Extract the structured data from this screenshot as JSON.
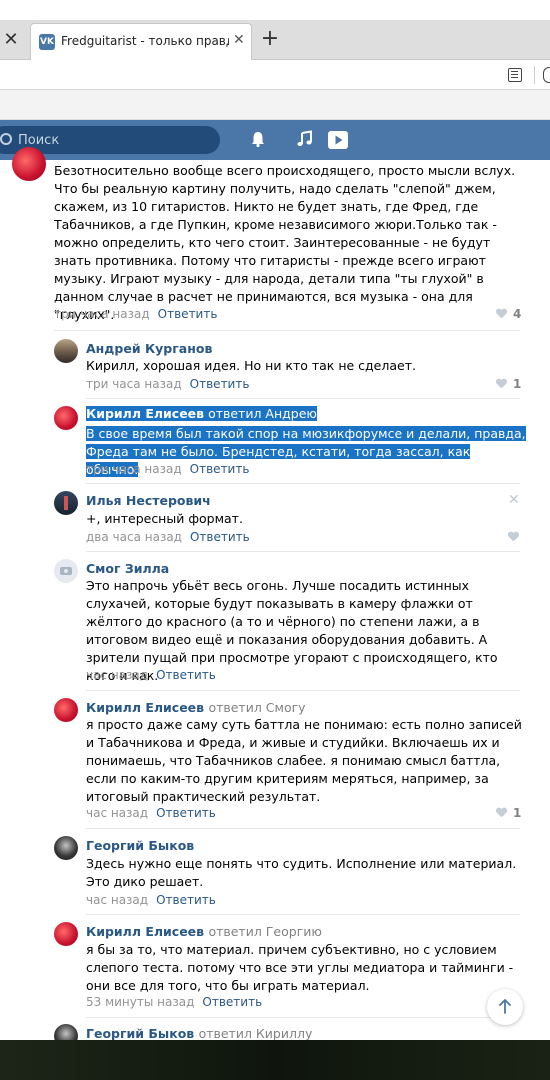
{
  "browser": {
    "tab_title": "Fredguitarist - только правда о",
    "favicon_label": "VK",
    "new_tab_label": "+",
    "close_label": "✕"
  },
  "header": {
    "search_placeholder": "Поиск"
  },
  "colors": {
    "vk_blue": "#4a76a8",
    "link": "#2a5885",
    "muted": "#939393",
    "selection": "#1a73c4"
  },
  "comments": [
    {
      "author": "",
      "text": "Безотносительно вообще всего происходящего, просто мысли вслух. Что бы реальную картину получить, надо сделать \"слепой\" джем, скажем, из 10 гитаристов. Никто не будет знать, где Фред, где Табачников, а где Пупкин, кроме независимого жюри.Только так - можно определить, кто чего стоит. Заинтересованные - не будут знать противника. Потому что гитаристы - прежде всего играют музыку. Играют музыку - для народа, детали типа \"ты глухой\" в данном случае в расчет не принимаются, вся музыка - она для \"глухих\".",
      "time": "три часа назад",
      "reply": "Ответить",
      "likes": "4"
    },
    {
      "author": "Андрей Курганов",
      "text": "Кирилл, хорошая идея. Но ни кто так не сделает.",
      "time": "три часа назад",
      "reply": "Ответить",
      "likes": "1"
    },
    {
      "author": "Кирилл Елисеев",
      "reply_to": "ответил Андрею",
      "text_line1": "В свое время был такой спор на мюзикфорумсе и делали, правда,",
      "text_line2": "Фреда там не было. Брендстед, кстати, тогда зассал, как обычно.",
      "time": "три часа назад",
      "reply": "Ответить"
    },
    {
      "author": "Илья Нестерович",
      "text": "+, интересный формат.",
      "time": "два часа назад",
      "reply": "Ответить"
    },
    {
      "author": "Смог Зилла",
      "text": "Это напрочь убьёт весь огонь. Лучше посадить истинных слухачей, которые будут показывать в камеру флажки от жёлтого до красного (а то и чёрного) по степени лажи, а в итоговом видео ещё и показания оборудования добавить. А зрители пущай при просмотре угорают с происходящего, кто кого и как.",
      "time": "час назад",
      "reply": "Ответить"
    },
    {
      "author": "Кирилл Елисеев",
      "reply_to": "ответил Смогу",
      "text": "я просто даже саму суть баттла не понимаю: есть полно записей и Табачникова и Фреда, и живые и студийки. Включаешь их и понимаешь, что Табачников слабее. я понимаю смысл баттла, если по каким-то другим критериям меряться, например, за итоговый практический результат.",
      "time": "час назад",
      "reply": "Ответить",
      "likes": "1"
    },
    {
      "author": "Георгий Быков",
      "text": "Здесь нужно еще понять что судить. Исполнение или материал. Это дико решает.",
      "time": "час назад",
      "reply": "Ответить"
    },
    {
      "author": "Кирилл Елисеев",
      "reply_to": "ответил Георгию",
      "text": "я бы за то, что материал. причем субъективно, но с условием слепого теста. потому что все эти углы медиатора и тайминги - они все для того, что бы играть материал.",
      "time": "53 минуты назад",
      "reply": "Ответить"
    },
    {
      "author": "Георгий Быков",
      "reply_to": "ответил Кириллу"
    }
  ]
}
